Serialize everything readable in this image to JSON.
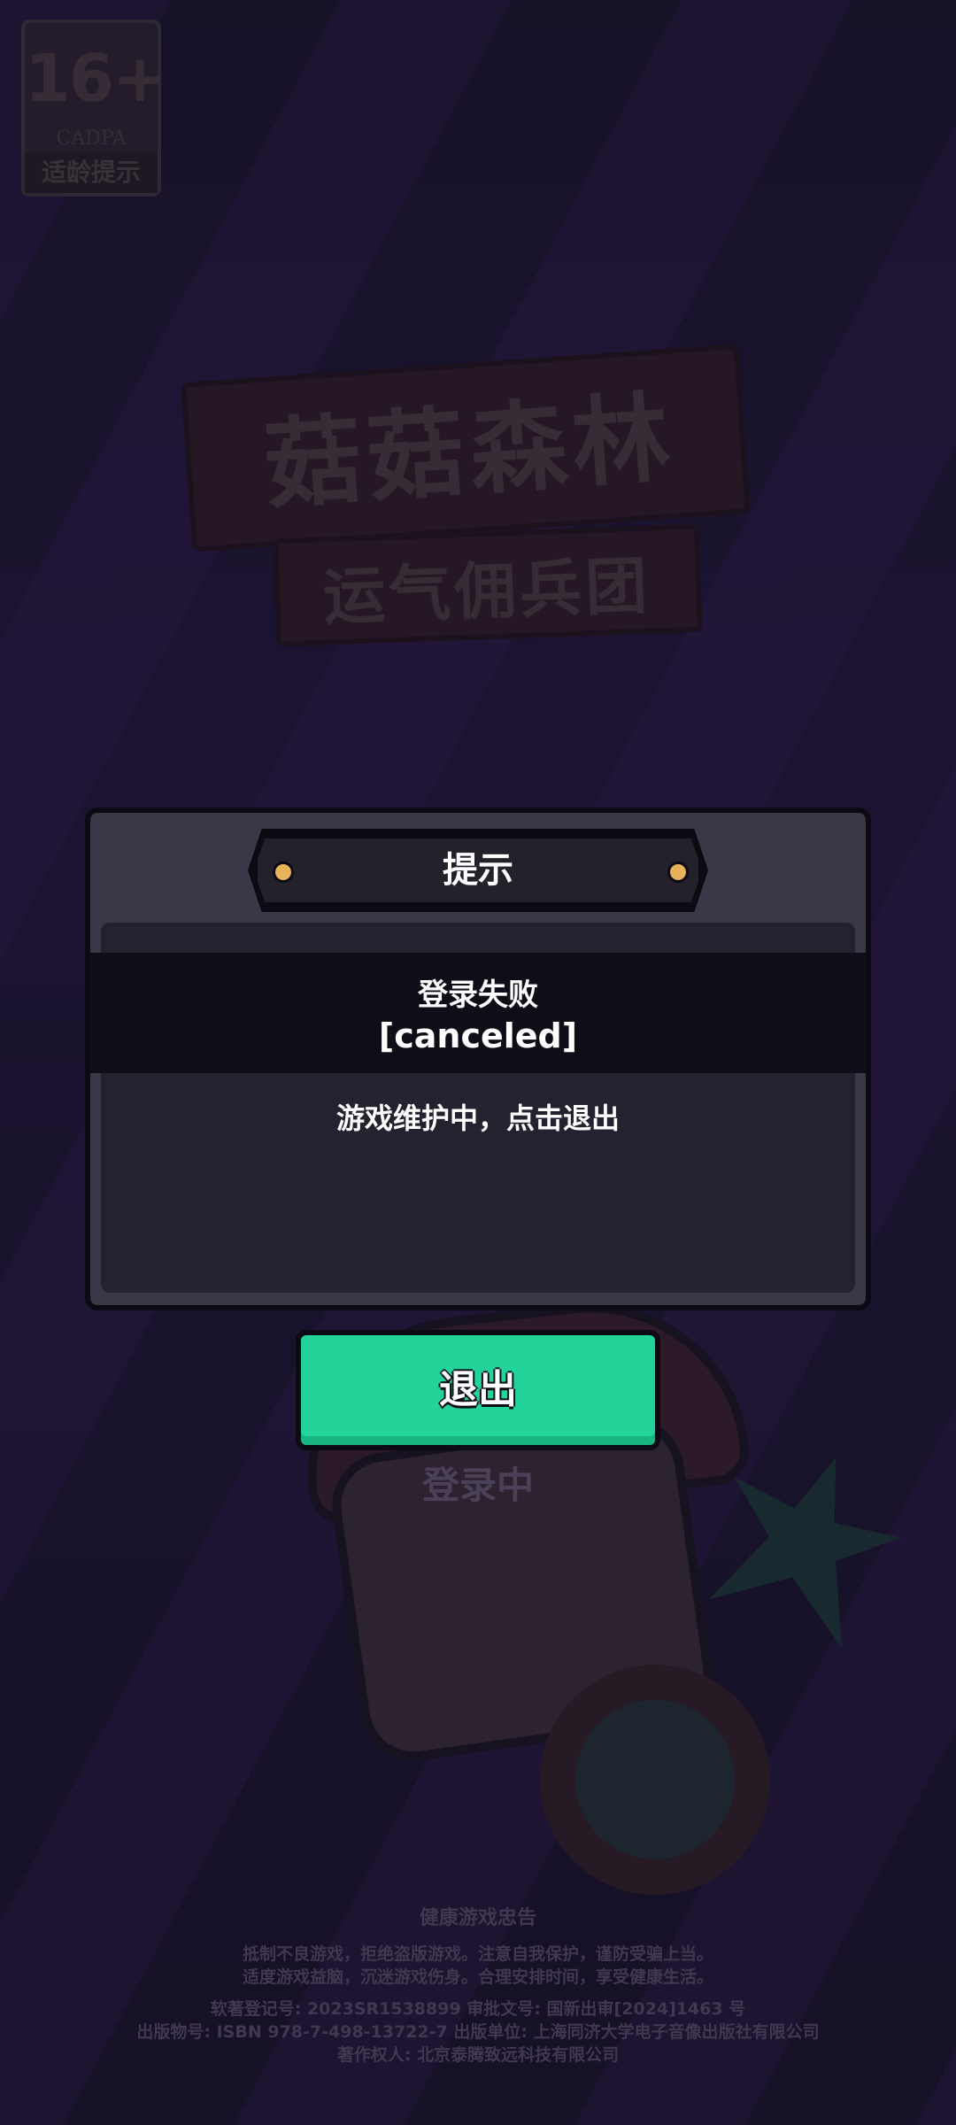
{
  "age_rating": {
    "age": "16+",
    "org": "CADPA",
    "label": "适龄提示"
  },
  "logo": {
    "title": "菇菇森林",
    "subtitle": "运气佣兵团"
  },
  "dialog": {
    "title": "提示",
    "error_title": "登录失败",
    "error_code": "[canceled]",
    "message": "游戏维护中，点击退出"
  },
  "exit_button": {
    "label": "退出"
  },
  "status_text": "登录中",
  "footer": {
    "title": "健康游戏忠告",
    "advice_lines": [
      "抵制不良游戏，拒绝盗版游戏。注意自我保护，谨防受骗上当。",
      "适度游戏益脑，沉迷游戏伤身。合理安排时间，享受健康生活。"
    ],
    "legal_lines": [
      "软著登记号: 2023SR1538899 审批文号: 国新出审[2024]1463 号",
      "出版物号: ISBN 978-7-498-13722-7 出版单位: 上海同济大学电子音像出版社有限公司",
      "著作权人: 北京泰腾致远科技有限公司"
    ]
  },
  "colors": {
    "button_green": "#22d39a",
    "rivet_gold": "#e6b25a",
    "dialog_bg": "#3b3747"
  }
}
